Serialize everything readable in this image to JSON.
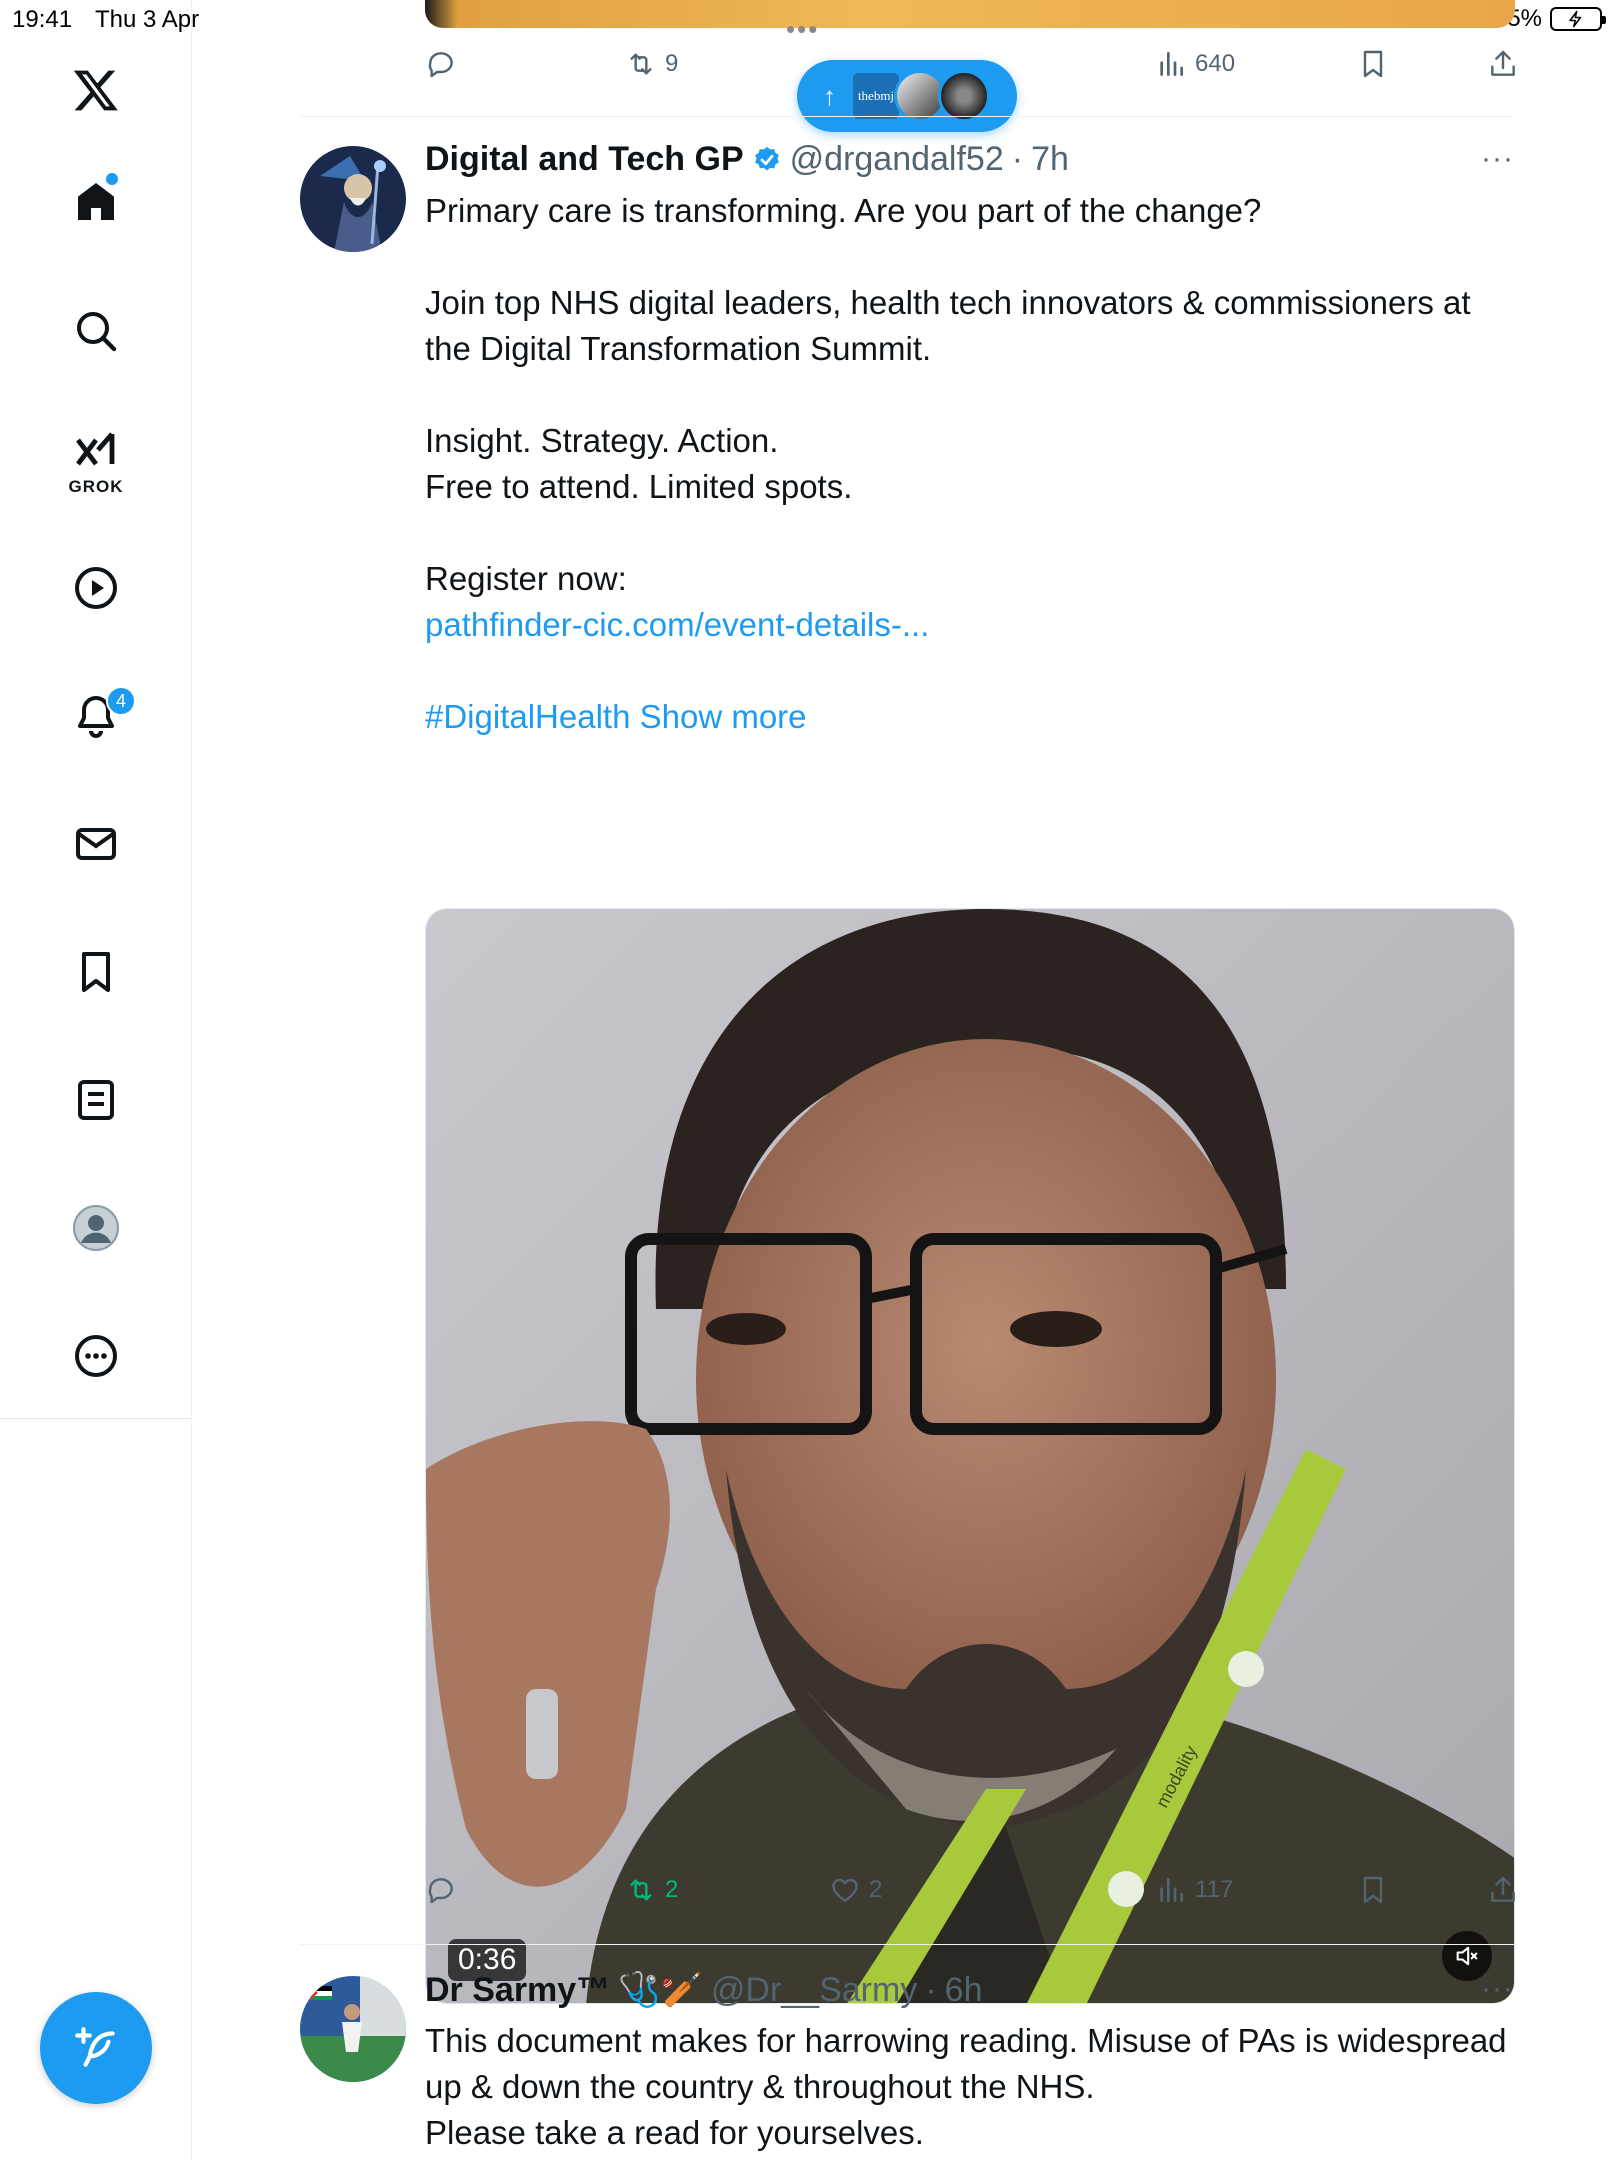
{
  "status_bar": {
    "time": "19:41",
    "date": "Thu 3 Apr",
    "battery": "5%"
  },
  "sidebar": {
    "logo": "x-logo-icon",
    "items": [
      {
        "name": "home",
        "icon": "home-icon",
        "has_dot": true
      },
      {
        "name": "explore",
        "icon": "search-icon"
      },
      {
        "name": "grok",
        "icon": "grok-icon",
        "label": "GROK"
      },
      {
        "name": "video",
        "icon": "play-icon"
      },
      {
        "name": "notifications",
        "icon": "bell-icon",
        "badge": "4"
      },
      {
        "name": "messages",
        "icon": "mail-icon"
      },
      {
        "name": "bookmarks",
        "icon": "bookmark-icon"
      },
      {
        "name": "lists",
        "icon": "list-icon"
      },
      {
        "name": "profile",
        "icon": "profile-icon"
      },
      {
        "name": "more",
        "icon": "more-icon"
      }
    ],
    "compose_icon": "compose-icon"
  },
  "prev_tweet": {
    "actions": {
      "reply": "",
      "retweet": "9",
      "like": "",
      "views": "640"
    }
  },
  "new_posts_pill": {
    "arrow": "↑",
    "avatar_1": "thebmj"
  },
  "tweet1": {
    "name": "Digital and Tech GP",
    "handle": "@drgandalf52",
    "sep": "·",
    "time": "7h",
    "more": "···",
    "lines": [
      "Primary care is transforming. Are you part of the change?",
      "",
      "Join top NHS digital leaders, health tech innovators & commissioners at the Digital Transformation Summit.",
      "",
      "Insight. Strategy. Action.",
      "Free to attend. Limited spots.",
      "",
      "Register now:"
    ],
    "link": "pathfinder-cic.com/event-details-...",
    "hashtag": "#DigitalHealth",
    "show_more": "Show more",
    "video": {
      "duration": "0:36",
      "lanyard_text": "modality"
    },
    "actions": {
      "reply": "",
      "retweet": "2",
      "like": "2",
      "views": "117"
    },
    "colors": {
      "retweet_active": "#00ba7c"
    }
  },
  "tweet2": {
    "name": "Dr Sarmy™",
    "emoji": "🩺🏏",
    "handle": "@Dr__Sarmy",
    "sep": "·",
    "time": "6h",
    "more": "···",
    "lines": [
      "This document makes for harrowing reading. Misuse of PAs is widespread up & down the country & throughout the NHS.",
      "Please take a read for yourselves."
    ]
  },
  "colors": {
    "accent": "#1d9bf0",
    "text": "#0f1419",
    "muted": "#536471"
  }
}
